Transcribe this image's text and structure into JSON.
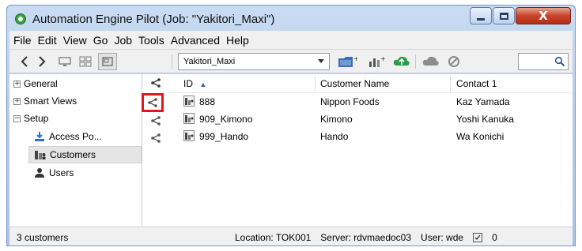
{
  "window": {
    "title": "Automation Engine Pilot (Job: \"Yakitori_Maxi\")",
    "close_glyph": "X"
  },
  "menu": [
    "File",
    "Edit",
    "View",
    "Go",
    "Job",
    "Tools",
    "Advanced",
    "Help"
  ],
  "toolbar": {
    "job_value": "Yakitori_Maxi",
    "search_value": ""
  },
  "sidebar": {
    "general": "General",
    "smart_views": "Smart Views",
    "setup": "Setup",
    "access_points": "Access Po...",
    "customers": "Customers",
    "users": "Users",
    "expand_glyph": "+",
    "collapse_glyph": "−"
  },
  "table": {
    "columns": [
      "ID",
      "Customer Name",
      "Contact 1"
    ],
    "sort_glyph": "▲",
    "rows": [
      {
        "id": "888",
        "name": "Nippon Foods",
        "contact": "Kaz Yamada"
      },
      {
        "id": "909_Kimono",
        "name": "Kimono",
        "contact": "Yoshi Kanuka"
      },
      {
        "id": "999_Hando",
        "name": "Hando",
        "contact": "Wa Konichi"
      }
    ]
  },
  "status": {
    "count": "3 customers",
    "location": "Location: TOK001",
    "server": "Server: rdvmaedoc03",
    "user": "User: wde",
    "inbox_count": "0"
  },
  "colors": {
    "highlight": "#e4141f",
    "app_icon": "#3aa53a",
    "close_button": "#c8432a"
  },
  "icons": [
    "app-icon",
    "back-arrow-icon",
    "forward-arrow-icon",
    "monitor-icon",
    "grid-icon",
    "frame-icon",
    "folder-add-icon",
    "chart-add-icon",
    "cloud-upload-icon",
    "cloud-icon",
    "cancel-icon",
    "search-icon",
    "share-icon",
    "customer-icon",
    "access-point-icon",
    "customers-icon",
    "user-icon",
    "inbox-icon"
  ]
}
